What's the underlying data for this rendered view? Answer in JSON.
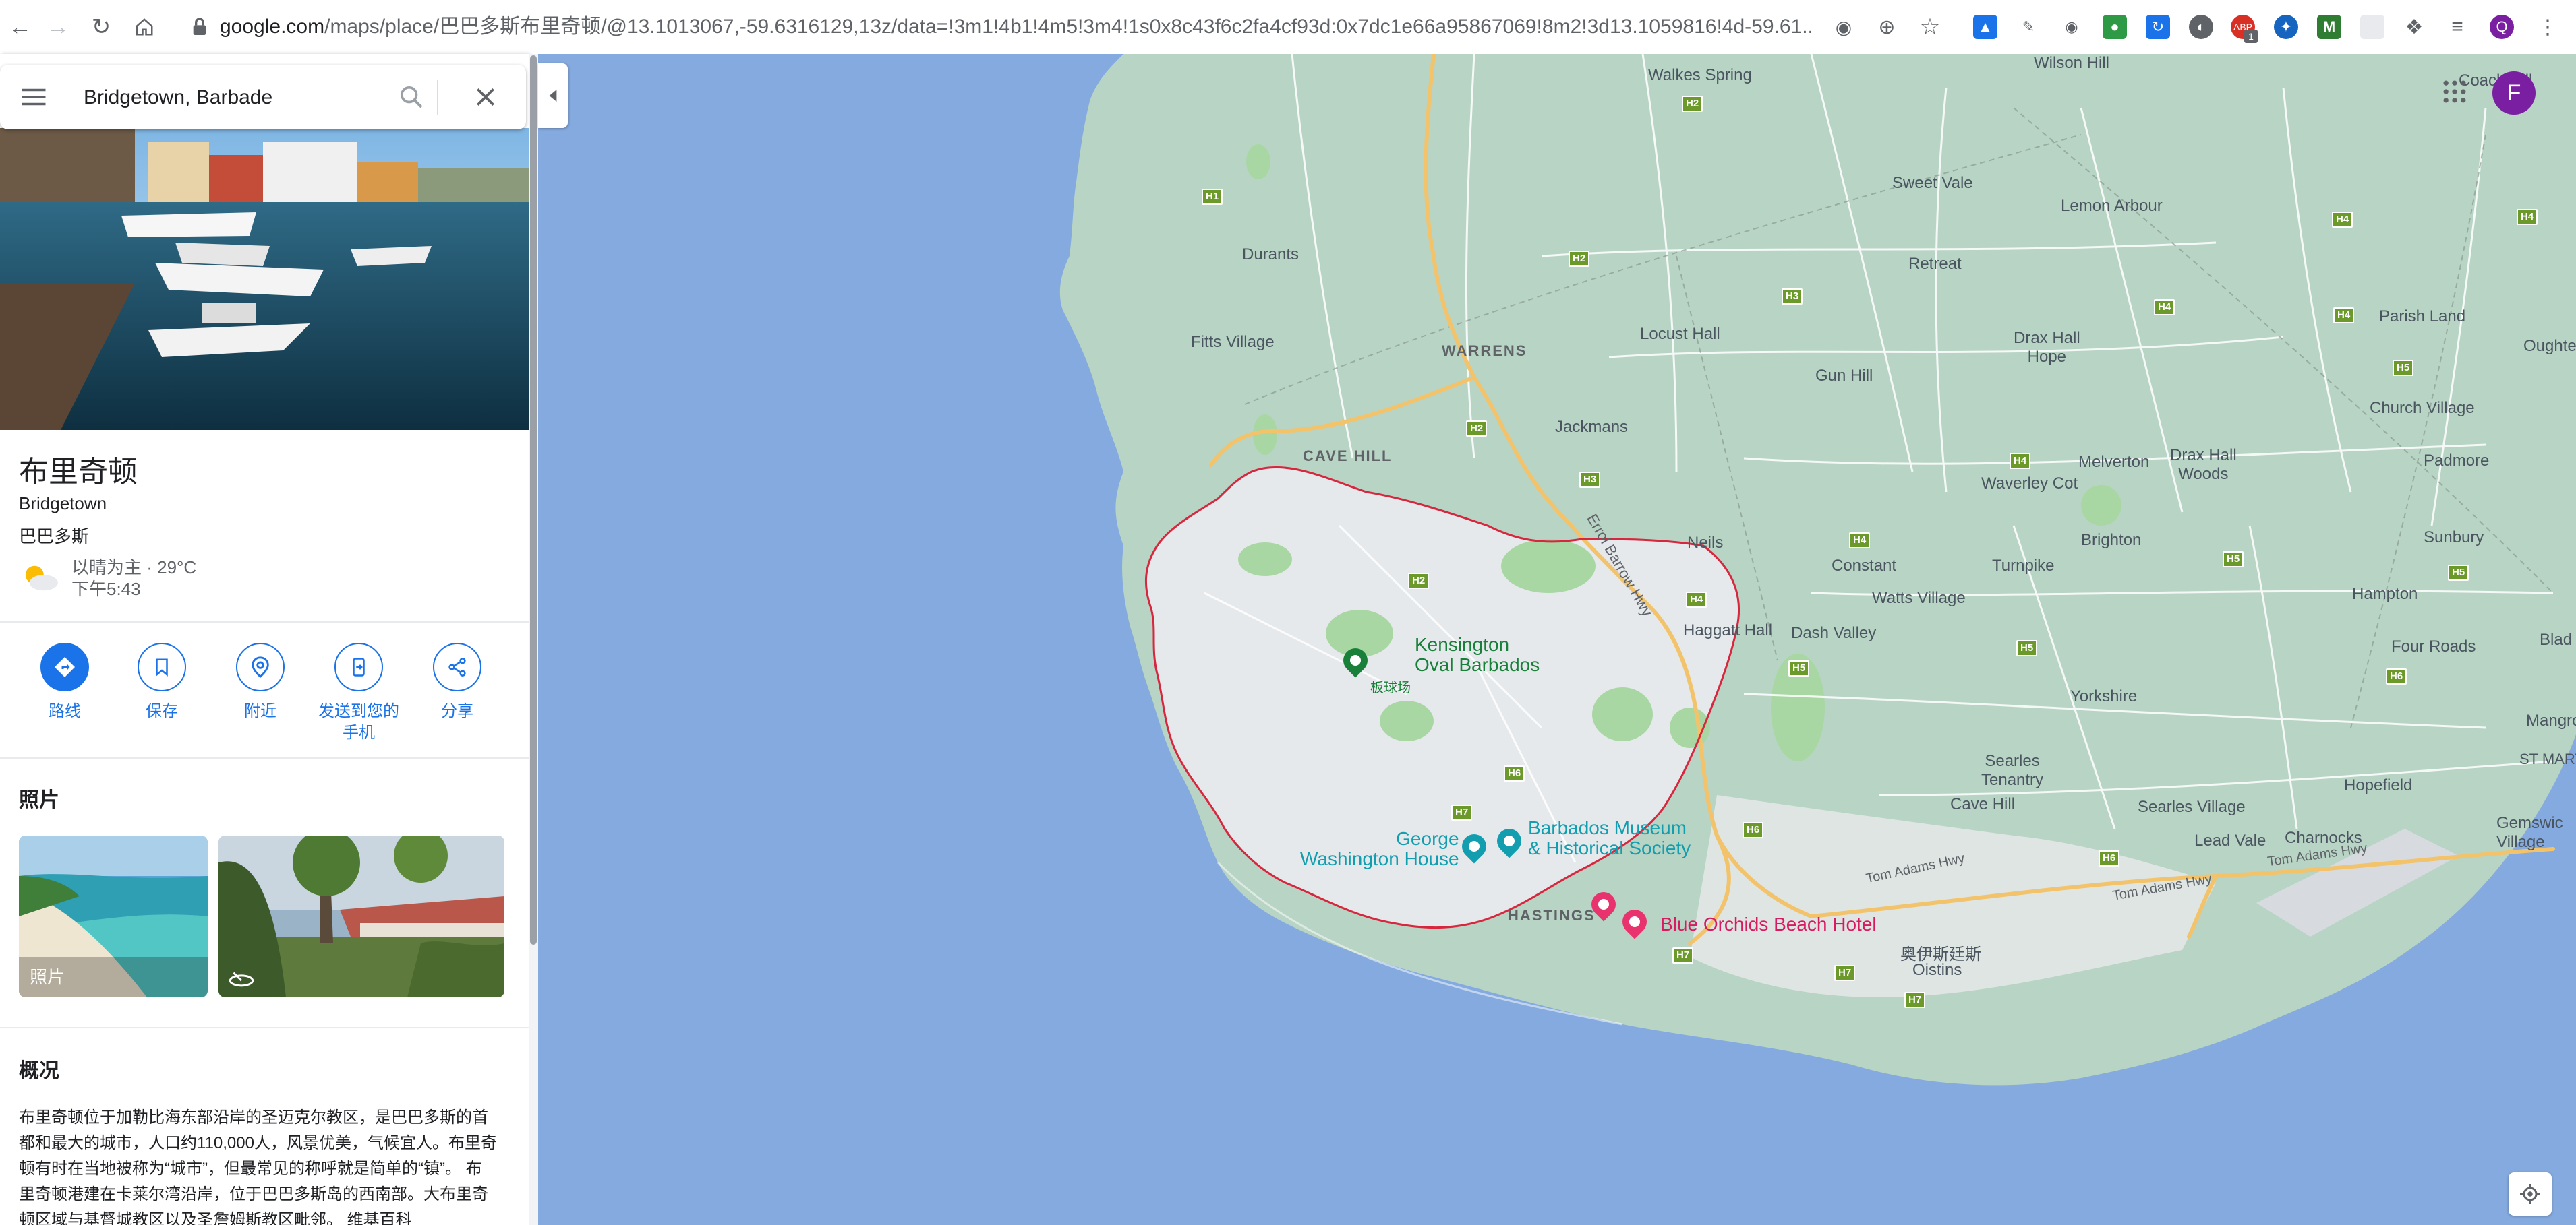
{
  "browser": {
    "url_domain": "google.com",
    "url_path": "/maps/place/巴巴多斯布里奇顿/@13.1013067,-59.6316129,13z/data=!3m1!4b1!4m5!3m4!1s0x8c43f6c2fa4cf93d:0x7dc1e66a95867069!8m2!3d13.1059816!4d-59.61...",
    "ext_badge": "1"
  },
  "search": {
    "value": "Bridgetown, Barbade"
  },
  "place": {
    "title": "布里奇顿",
    "subtitle": "Bridgetown",
    "country": "巴巴多斯",
    "weather_line1": "以晴为主 · 29°C",
    "weather_line2": "下午5:43"
  },
  "actions": [
    {
      "label": "路线"
    },
    {
      "label": "保存"
    },
    {
      "label": "附近"
    },
    {
      "label": "发送到您的\n手机"
    },
    {
      "label": "分享"
    }
  ],
  "photos": {
    "heading": "照片",
    "tile1_label": "照片"
  },
  "overview": {
    "heading": "概况",
    "text": "布里奇顿位于加勒比海东部沿岸的圣迈克尔教区，是巴巴多斯的首都和最大的城市，人口约110,000人，风景优美，气候宜人。布里奇顿有时在当地被称为“城市”，但最常见的称呼就是简单的“镇”。 布里奇顿港建在卡莱尔湾沿岸，位于巴巴多斯岛的西南部。大布里奇顿区域与基督城教区以及圣詹姆斯教区毗邻。",
    "link": "维基百科"
  },
  "account": {
    "initial": "F"
  },
  "map": {
    "labels": {
      "walkes_spring": "Walkes Spring",
      "wilson_hill": "Wilson Hill",
      "coach_hill": "Coach Hill",
      "sweet_vale": "Sweet Vale",
      "lemon_arbour": "Lemon Arbour",
      "durants": "Durants",
      "retreat": "Retreat",
      "parish_land": "Parish Land",
      "oughterson": "Oughterso",
      "fitts_village": "Fitts Village",
      "warrens": "WARRENS",
      "locust_hall": "Locust Hall",
      "drax_hall_hope": "Drax Hall\nHope",
      "gun_hill": "Gun Hill",
      "church_village": "Church Village",
      "jackmans": "Jackmans",
      "cave_hill": "CAVE HILL",
      "melverton": "Melverton",
      "drax_hall_woods": "Drax Hall\nWoods",
      "waverley_cot": "Waverley Cot",
      "padmore": "Padmore",
      "neils": "Neils",
      "brighton": "Brighton",
      "sunbury": "Sunbury",
      "constant": "Constant",
      "turnpike": "Turnpike",
      "watts_village": "Watts Village",
      "hampton": "Hampton",
      "haggatt_hall": "Haggatt Hall",
      "dash_valley": "Dash Valley",
      "four_roads": "Four Roads",
      "blades": "Blad",
      "kensington": "Kensington\nOval Barbados",
      "kensington_zh": "板球场",
      "yorkshire": "Yorkshire",
      "mangrove": "Mangrov",
      "st_martins": "ST MARTIN",
      "searles_tenantry": "Searles\nTenantry",
      "hopefield": "Hopefield",
      "cave_hill_2": "Cave Hill",
      "searles_village": "Searles Village",
      "gemswick": "Gemswic\nVillage",
      "museum": "Barbados Museum\n& Historical Society",
      "george_washington": "George\nWashington House",
      "lead_vale": "Lead Vale",
      "charnocks": "Charnocks",
      "hastings": "HASTINGS",
      "blue_orchids": "Blue Orchids Beach Hotel",
      "oistins_zh": "奥伊斯廷斯",
      "oistins": "Oistins",
      "errol_barrow": "Errol Barrow Hwy",
      "tom_adams_1": "Tom Adams Hwy",
      "tom_adams_2": "Tom Adams Hwy",
      "tom_adams_3": "Tom Adams Hwy"
    },
    "shields": [
      "H2",
      "H1",
      "H2",
      "H3",
      "H2",
      "H3",
      "H4",
      "H4",
      "H4",
      "H4",
      "H5",
      "H2",
      "H4",
      "H5",
      "H5",
      "H6",
      "H6",
      "H7",
      "H6",
      "H5",
      "H6",
      "H7",
      "H7",
      "H7",
      "H4",
      "H4",
      "H5"
    ]
  },
  "colors": {
    "water": "#85aadf",
    "land": "#b8d4c5",
    "urban": "#e6e9ec",
    "park": "#a8d7a4",
    "highway": "#f2c36b",
    "boundary": "#d7263d",
    "accent": "#1a73e8"
  }
}
